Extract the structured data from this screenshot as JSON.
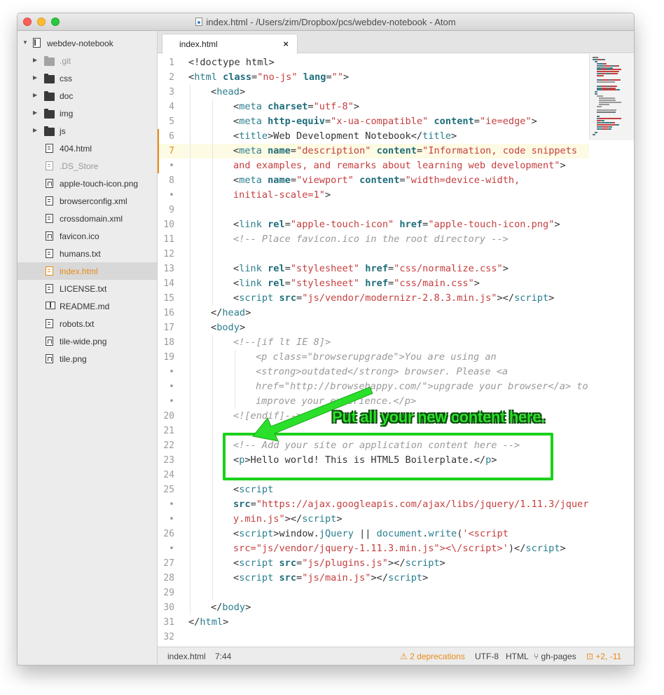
{
  "window": {
    "title": "index.html - /Users/zim/Dropbox/pcs/webdev-notebook - Atom"
  },
  "sidebar": {
    "root": "webdev-notebook",
    "items": [
      {
        "label": ".git",
        "kind": "folder",
        "dim": true
      },
      {
        "label": "css",
        "kind": "folder"
      },
      {
        "label": "doc",
        "kind": "folder"
      },
      {
        "label": "img",
        "kind": "folder"
      },
      {
        "label": "js",
        "kind": "folder"
      },
      {
        "label": "404.html",
        "kind": "file"
      },
      {
        "label": ".DS_Store",
        "kind": "file",
        "dim": true
      },
      {
        "label": "apple-touch-icon.png",
        "kind": "image"
      },
      {
        "label": "browserconfig.xml",
        "kind": "file"
      },
      {
        "label": "crossdomain.xml",
        "kind": "file"
      },
      {
        "label": "favicon.ico",
        "kind": "image"
      },
      {
        "label": "humans.txt",
        "kind": "file"
      },
      {
        "label": "index.html",
        "kind": "file",
        "selected": true
      },
      {
        "label": "LICENSE.txt",
        "kind": "file"
      },
      {
        "label": "README.md",
        "kind": "book"
      },
      {
        "label": "robots.txt",
        "kind": "file"
      },
      {
        "label": "tile-wide.png",
        "kind": "image"
      },
      {
        "label": "tile.png",
        "kind": "image"
      }
    ]
  },
  "tab": {
    "label": "index.html",
    "close": "×"
  },
  "editor": {
    "cursor_line": 7,
    "lines": [
      {
        "n": "1",
        "indent": 0,
        "tokens": [
          [
            "p",
            "<!doctype html>"
          ]
        ]
      },
      {
        "n": "2",
        "indent": 0,
        "tokens": [
          [
            "p",
            "<"
          ],
          [
            "t",
            "html"
          ],
          [
            "p",
            " "
          ],
          [
            "a",
            "class"
          ],
          [
            "p",
            "="
          ],
          [
            "s",
            "\"no-js\""
          ],
          [
            "p",
            " "
          ],
          [
            "a",
            "lang"
          ],
          [
            "p",
            "="
          ],
          [
            "s",
            "\"\""
          ],
          [
            "p",
            ">"
          ]
        ]
      },
      {
        "n": "3",
        "indent": 1,
        "tokens": [
          [
            "p",
            "<"
          ],
          [
            "t",
            "head"
          ],
          [
            "p",
            ">"
          ]
        ]
      },
      {
        "n": "4",
        "indent": 2,
        "tokens": [
          [
            "p",
            "<"
          ],
          [
            "t",
            "meta"
          ],
          [
            "p",
            " "
          ],
          [
            "a",
            "charset"
          ],
          [
            "p",
            "="
          ],
          [
            "s",
            "\"utf-8\""
          ],
          [
            "p",
            ">"
          ]
        ]
      },
      {
        "n": "5",
        "indent": 2,
        "tokens": [
          [
            "p",
            "<"
          ],
          [
            "t",
            "meta"
          ],
          [
            "p",
            " "
          ],
          [
            "a",
            "http-equiv"
          ],
          [
            "p",
            "="
          ],
          [
            "s",
            "\"x-ua-compatible\""
          ],
          [
            "p",
            " "
          ],
          [
            "a",
            "content"
          ],
          [
            "p",
            "="
          ],
          [
            "s",
            "\"ie=edge\""
          ],
          [
            "p",
            ">"
          ]
        ]
      },
      {
        "n": "6",
        "indent": 2,
        "git": true,
        "tokens": [
          [
            "p",
            "<"
          ],
          [
            "t",
            "title"
          ],
          [
            "p",
            ">Web Development Notebook</"
          ],
          [
            "t",
            "title"
          ],
          [
            "p",
            ">"
          ]
        ]
      },
      {
        "n": "7",
        "indent": 2,
        "git": true,
        "cursor": true,
        "tokens": [
          [
            "p",
            "<"
          ],
          [
            "t",
            "meta"
          ],
          [
            "p",
            " "
          ],
          [
            "a",
            "name"
          ],
          [
            "p",
            "="
          ],
          [
            "s",
            "\"description\""
          ],
          [
            "p",
            " "
          ],
          [
            "a",
            "content"
          ],
          [
            "p",
            "="
          ],
          [
            "s",
            "\"Information, code snippets"
          ]
        ]
      },
      {
        "n": "•",
        "indent": 2,
        "git": true,
        "tokens": [
          [
            "s",
            "and examples, and remarks about learning web development\""
          ],
          [
            "p",
            ">"
          ]
        ]
      },
      {
        "n": "8",
        "indent": 2,
        "tokens": [
          [
            "p",
            "<"
          ],
          [
            "t",
            "meta"
          ],
          [
            "p",
            " "
          ],
          [
            "a",
            "name"
          ],
          [
            "p",
            "="
          ],
          [
            "s",
            "\"viewport\""
          ],
          [
            "p",
            " "
          ],
          [
            "a",
            "content"
          ],
          [
            "p",
            "="
          ],
          [
            "s",
            "\"width=device-width,"
          ]
        ]
      },
      {
        "n": "•",
        "indent": 2,
        "tokens": [
          [
            "s",
            "initial-scale=1\""
          ],
          [
            "p",
            ">"
          ]
        ]
      },
      {
        "n": "9",
        "indent": 2,
        "tokens": []
      },
      {
        "n": "10",
        "indent": 2,
        "tokens": [
          [
            "p",
            "<"
          ],
          [
            "t",
            "link"
          ],
          [
            "p",
            " "
          ],
          [
            "a",
            "rel"
          ],
          [
            "p",
            "="
          ],
          [
            "s",
            "\"apple-touch-icon\""
          ],
          [
            "p",
            " "
          ],
          [
            "a",
            "href"
          ],
          [
            "p",
            "="
          ],
          [
            "s",
            "\"apple-touch-icon.png\""
          ],
          [
            "p",
            ">"
          ]
        ]
      },
      {
        "n": "11",
        "indent": 2,
        "tokens": [
          [
            "c",
            "<!-- Place favicon.ico in the root directory -->"
          ]
        ]
      },
      {
        "n": "12",
        "indent": 2,
        "tokens": []
      },
      {
        "n": "13",
        "indent": 2,
        "tokens": [
          [
            "p",
            "<"
          ],
          [
            "t",
            "link"
          ],
          [
            "p",
            " "
          ],
          [
            "a",
            "rel"
          ],
          [
            "p",
            "="
          ],
          [
            "s",
            "\"stylesheet\""
          ],
          [
            "p",
            " "
          ],
          [
            "a",
            "href"
          ],
          [
            "p",
            "="
          ],
          [
            "s",
            "\"css/normalize.css\""
          ],
          [
            "p",
            ">"
          ]
        ]
      },
      {
        "n": "14",
        "indent": 2,
        "tokens": [
          [
            "p",
            "<"
          ],
          [
            "t",
            "link"
          ],
          [
            "p",
            " "
          ],
          [
            "a",
            "rel"
          ],
          [
            "p",
            "="
          ],
          [
            "s",
            "\"stylesheet\""
          ],
          [
            "p",
            " "
          ],
          [
            "a",
            "href"
          ],
          [
            "p",
            "="
          ],
          [
            "s",
            "\"css/main.css\""
          ],
          [
            "p",
            ">"
          ]
        ]
      },
      {
        "n": "15",
        "indent": 2,
        "tokens": [
          [
            "p",
            "<"
          ],
          [
            "t",
            "script"
          ],
          [
            "p",
            " "
          ],
          [
            "a",
            "src"
          ],
          [
            "p",
            "="
          ],
          [
            "s",
            "\"js/vendor/modernizr-2.8.3.min.js\""
          ],
          [
            "p",
            "></"
          ],
          [
            "t",
            "script"
          ],
          [
            "p",
            ">"
          ]
        ]
      },
      {
        "n": "16",
        "indent": 1,
        "tokens": [
          [
            "p",
            "</"
          ],
          [
            "t",
            "head"
          ],
          [
            "p",
            ">"
          ]
        ]
      },
      {
        "n": "17",
        "indent": 1,
        "tokens": [
          [
            "p",
            "<"
          ],
          [
            "t",
            "body"
          ],
          [
            "p",
            ">"
          ]
        ]
      },
      {
        "n": "18",
        "indent": 2,
        "tokens": [
          [
            "c",
            "<!--[if lt IE 8]>"
          ]
        ]
      },
      {
        "n": "19",
        "indent": 3,
        "tokens": [
          [
            "c",
            "<p class=\"browserupgrade\">You are using an"
          ]
        ]
      },
      {
        "n": "•",
        "indent": 3,
        "tokens": [
          [
            "c",
            "<strong>outdated</strong> browser. Please <a"
          ]
        ]
      },
      {
        "n": "•",
        "indent": 3,
        "tokens": [
          [
            "c",
            "href=\"http://browsehappy.com/\">upgrade your browser</a> to"
          ]
        ]
      },
      {
        "n": "•",
        "indent": 3,
        "tokens": [
          [
            "c",
            "improve your experience.</p>"
          ]
        ]
      },
      {
        "n": "20",
        "indent": 2,
        "tokens": [
          [
            "c",
            "<![endif]-->"
          ]
        ]
      },
      {
        "n": "21",
        "indent": 2,
        "tokens": []
      },
      {
        "n": "22",
        "indent": 2,
        "tokens": [
          [
            "c",
            "<!-- Add your site or application content here -->"
          ]
        ]
      },
      {
        "n": "23",
        "indent": 2,
        "tokens": [
          [
            "p",
            "<"
          ],
          [
            "t",
            "p"
          ],
          [
            "p",
            ">Hello world! This is HTML5 Boilerplate.</"
          ],
          [
            "t",
            "p"
          ],
          [
            "p",
            ">"
          ]
        ]
      },
      {
        "n": "24",
        "indent": 2,
        "tokens": []
      },
      {
        "n": "25",
        "indent": 2,
        "tokens": [
          [
            "p",
            "<"
          ],
          [
            "t",
            "script"
          ]
        ]
      },
      {
        "n": "•",
        "indent": 2,
        "tokens": [
          [
            "a",
            "src"
          ],
          [
            "p",
            "="
          ],
          [
            "s",
            "\"https://ajax.googleapis.com/ajax/libs/jquery/1.11.3/jquer"
          ]
        ]
      },
      {
        "n": "•",
        "indent": 2,
        "tokens": [
          [
            "s",
            "y.min.js\""
          ],
          [
            "p",
            "></"
          ],
          [
            "t",
            "script"
          ],
          [
            "p",
            ">"
          ]
        ]
      },
      {
        "n": "26",
        "indent": 2,
        "tokens": [
          [
            "p",
            "<"
          ],
          [
            "t",
            "script"
          ],
          [
            "p",
            ">window."
          ],
          [
            "t",
            "jQuery"
          ],
          [
            "p",
            " || "
          ],
          [
            "t",
            "document"
          ],
          [
            "p",
            "."
          ],
          [
            "t",
            "write"
          ],
          [
            "p",
            "("
          ],
          [
            "s",
            "'<script"
          ]
        ]
      },
      {
        "n": "•",
        "indent": 2,
        "tokens": [
          [
            "s",
            "src=\"js/vendor/jquery-1.11.3.min.js\"><\\/script>'"
          ],
          [
            "p",
            ")</"
          ],
          [
            "t",
            "script"
          ],
          [
            "p",
            ">"
          ]
        ]
      },
      {
        "n": "27",
        "indent": 2,
        "tokens": [
          [
            "p",
            "<"
          ],
          [
            "t",
            "script"
          ],
          [
            "p",
            " "
          ],
          [
            "a",
            "src"
          ],
          [
            "p",
            "="
          ],
          [
            "s",
            "\"js/plugins.js\""
          ],
          [
            "p",
            "></"
          ],
          [
            "t",
            "script"
          ],
          [
            "p",
            ">"
          ]
        ]
      },
      {
        "n": "28",
        "indent": 2,
        "tokens": [
          [
            "p",
            "<"
          ],
          [
            "t",
            "script"
          ],
          [
            "p",
            " "
          ],
          [
            "a",
            "src"
          ],
          [
            "p",
            "="
          ],
          [
            "s",
            "\"js/main.js\""
          ],
          [
            "p",
            "></"
          ],
          [
            "t",
            "script"
          ],
          [
            "p",
            ">"
          ]
        ]
      },
      {
        "n": "29",
        "indent": 2,
        "tokens": []
      },
      {
        "n": "30",
        "indent": 1,
        "tokens": [
          [
            "p",
            "</"
          ],
          [
            "t",
            "body"
          ],
          [
            "p",
            ">"
          ]
        ]
      },
      {
        "n": "31",
        "indent": 0,
        "tokens": [
          [
            "p",
            "</"
          ],
          [
            "t",
            "html"
          ],
          [
            "p",
            ">"
          ]
        ]
      },
      {
        "n": "32",
        "indent": 0,
        "tokens": []
      }
    ]
  },
  "annotation": {
    "text": "Put all your new content here."
  },
  "statusbar": {
    "file": "index.html",
    "position": "7:44",
    "deprecations": "2 deprecations",
    "encoding": "UTF-8",
    "grammar": "HTML",
    "branch": "gh-pages",
    "diff": "+2, -11"
  },
  "colors": {
    "accent": "#e88b1a",
    "annotation": "#1ad11a",
    "tag": "#2a7e8f",
    "string": "#c53e3e",
    "comment": "#999999"
  }
}
